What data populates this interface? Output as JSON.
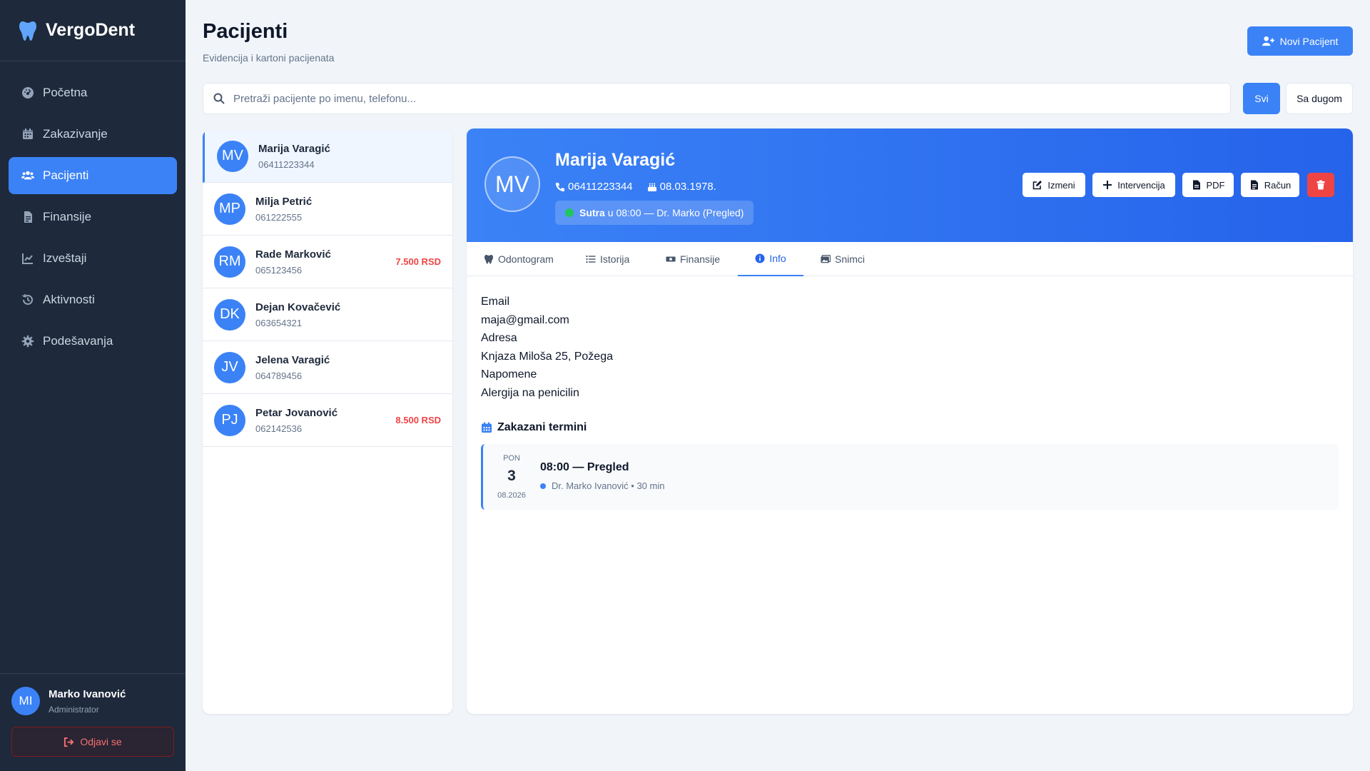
{
  "app": {
    "name": "VergoDent"
  },
  "sidebar": {
    "items": [
      {
        "label": "Početna"
      },
      {
        "label": "Zakazivanje"
      },
      {
        "label": "Pacijenti"
      },
      {
        "label": "Finansije"
      },
      {
        "label": "Izveštaji"
      },
      {
        "label": "Aktivnosti"
      },
      {
        "label": "Podešavanja"
      }
    ],
    "active": "Pacijenti",
    "user": {
      "initials": "MI",
      "name": "Marko Ivanović",
      "role": "Administrator"
    },
    "logout_label": "Odjavi se"
  },
  "header": {
    "title": "Pacijenti",
    "subtitle": "Evidencija i kartoni pacijenata",
    "new_button": "Novi Pacijent"
  },
  "search": {
    "placeholder": "Pretraži pacijente po imenu, telefonu...",
    "value": ""
  },
  "filters": {
    "all": "Svi",
    "debt": "Sa dugom",
    "selected": "Svi"
  },
  "patients": [
    {
      "initials": "MV",
      "name": "Marija Varagić",
      "phone": "06411223344",
      "debt": ""
    },
    {
      "initials": "MP",
      "name": "Milja Petrić",
      "phone": "061222555",
      "debt": ""
    },
    {
      "initials": "RM",
      "name": "Rade Marković",
      "phone": "065123456",
      "debt": "7.500 RSD"
    },
    {
      "initials": "DK",
      "name": "Dejan Kovačević",
      "phone": "063654321",
      "debt": ""
    },
    {
      "initials": "JV",
      "name": "Jelena Varagić",
      "phone": "064789456",
      "debt": ""
    },
    {
      "initials": "PJ",
      "name": "Petar Jovanović",
      "phone": "062142536",
      "debt": "8.500 RSD"
    }
  ],
  "detail": {
    "initials": "MV",
    "name": "Marija Varagić",
    "phone": "06411223344",
    "birthdate": "08.03.1978.",
    "next_appointment": {
      "when": "Sutra",
      "rest": "u 08:00 — Dr. Marko (Pregled)"
    },
    "actions": {
      "edit": "Izmeni",
      "intervention": "Intervencija",
      "pdf": "PDF",
      "invoice": "Račun"
    },
    "tabs": [
      "Odontogram",
      "Istorija",
      "Finansije",
      "Info",
      "Snimci"
    ],
    "active_tab": "Info",
    "info": {
      "email_label": "Email",
      "email": "maja@gmail.com",
      "address_label": "Adresa",
      "address": "Knjaza Miloša 25, Požega",
      "notes_label": "Napomene",
      "notes": "Alergija na penicilin"
    },
    "scheduled": {
      "title": "Zakazani termini",
      "items": [
        {
          "dow": "PON",
          "day": "3",
          "month_year": "08.2026",
          "title": "08:00 — Pregled",
          "doctor": "Dr. Marko Ivanović",
          "duration": "30 min"
        }
      ]
    }
  },
  "colors": {
    "accent": "#3b82f6",
    "sidebar": "#1e293b",
    "danger": "#ef4444",
    "success": "#22c55e"
  }
}
